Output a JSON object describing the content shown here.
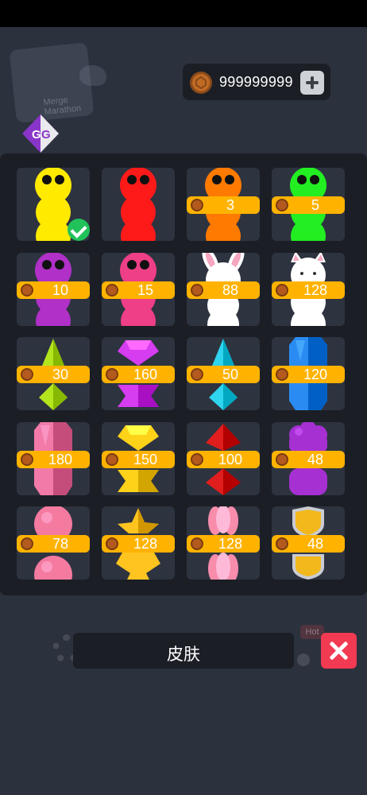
{
  "header": {
    "coins": "999999999"
  },
  "background_logo": {
    "text": "Merge Marathon"
  },
  "background_hot_badge": "Hot",
  "skins": [
    {
      "name": "yellow-snake",
      "type": "snake",
      "color": "#ffea00",
      "selected": true,
      "price": ""
    },
    {
      "name": "red-snake",
      "type": "snake",
      "color": "#ff1a1a",
      "price": ""
    },
    {
      "name": "orange-snake",
      "type": "snake",
      "color": "#ff7a00",
      "price": "3"
    },
    {
      "name": "green-snake",
      "type": "snake",
      "color": "#22ee22",
      "price": "5"
    },
    {
      "name": "purple-snake",
      "type": "snake",
      "color": "#b030c8",
      "price": "10"
    },
    {
      "name": "pink-snake",
      "type": "snake",
      "color": "#ee3f87",
      "price": "15"
    },
    {
      "name": "bunny",
      "type": "bunny",
      "color": "#ffffff",
      "price": "88"
    },
    {
      "name": "cat",
      "type": "cat",
      "color": "#ffffff",
      "price": "128"
    },
    {
      "name": "lime-spike-gem",
      "type": "spike",
      "color": "#b4e61e",
      "price": "30"
    },
    {
      "name": "magenta-gem",
      "type": "gem",
      "color": "#d63cf0",
      "price": "160"
    },
    {
      "name": "cyan-spike-gem",
      "type": "spike",
      "color": "#2fd4ee",
      "price": "50"
    },
    {
      "name": "blue-crystal",
      "type": "crystal",
      "color": "#2a8cf2",
      "price": "120"
    },
    {
      "name": "pink-crystal",
      "type": "crystal",
      "color": "#f27aa8",
      "price": "180"
    },
    {
      "name": "yellow-gem",
      "type": "gem",
      "color": "#ffd21a",
      "price": "150"
    },
    {
      "name": "red-diamond",
      "type": "diamond",
      "color": "#e01e1e",
      "price": "100"
    },
    {
      "name": "purple-blob",
      "type": "blob",
      "color": "#a630d2",
      "price": "48"
    },
    {
      "name": "pink-ball",
      "type": "ball",
      "color": "#f57aa0",
      "price": "78"
    },
    {
      "name": "gold-star",
      "type": "star",
      "color": "#ffc41f",
      "price": "128"
    },
    {
      "name": "pink-jelly",
      "type": "jelly",
      "color": "#f78cab",
      "price": "128"
    },
    {
      "name": "gold-shield",
      "type": "shield",
      "color": "#f2b81c",
      "price": "48"
    }
  ],
  "peek_colors": [
    "#f0a040",
    "#3ea86a",
    "#2a8f8a",
    "#d8d8d8"
  ],
  "bottom": {
    "title": "皮肤"
  },
  "colors": {
    "background": "#2b313d",
    "panel": "#1b1e25",
    "price_badge": "#ffb300",
    "close_button": "#f23a52",
    "selected_check": "#21c25a"
  }
}
